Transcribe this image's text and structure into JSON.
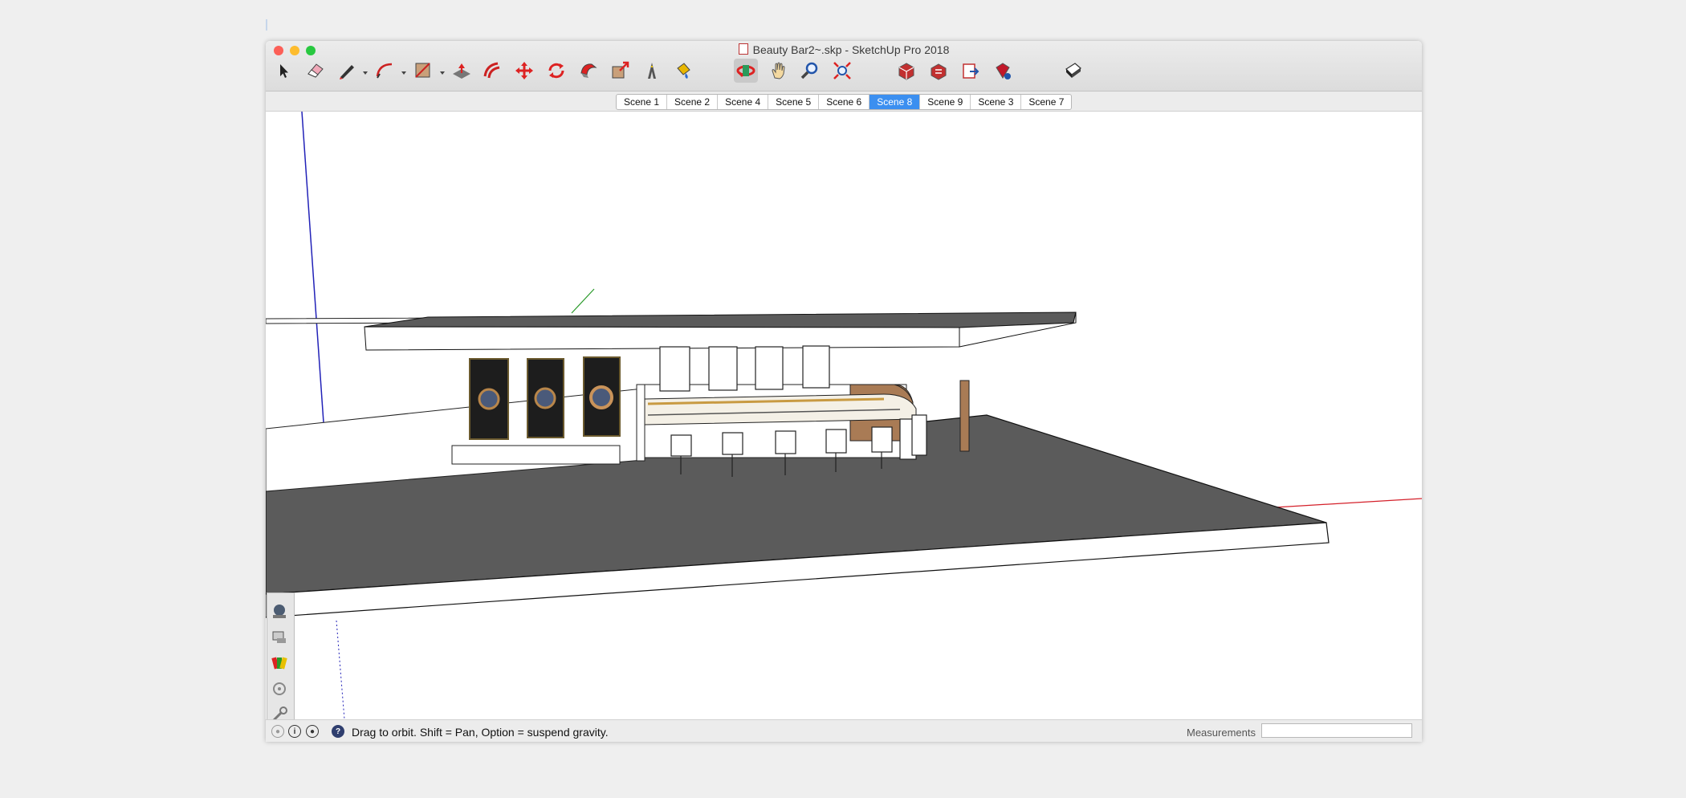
{
  "window": {
    "title": "Beauty Bar2~.skp - SketchUp Pro 2018",
    "traffic_colors": [
      "#fc5f57",
      "#fdbc2e",
      "#28c840"
    ]
  },
  "toolbar": {
    "tools": [
      "select-tool",
      "eraser-tool",
      "line-tool",
      "arc-tool",
      "rectangle-tool",
      "push-pull-tool",
      "offset-tool",
      "move-tool",
      "rotate-tool",
      "follow-me-tool",
      "scale-tool",
      "tape-measure-tool",
      "paint-bucket-tool",
      "orbit-tool",
      "pan-tool",
      "zoom-tool",
      "zoom-extents-tool",
      "warehouse-tool",
      "share-model-tool",
      "send-to-layout-tool",
      "extension-warehouse-tool",
      "display-toggle-tool"
    ],
    "active_tool": "orbit-tool"
  },
  "scenes": {
    "tabs": [
      "Scene 1",
      "Scene 2",
      "Scene 4",
      "Scene 5",
      "Scene 6",
      "Scene 8",
      "Scene 9",
      "Scene 3",
      "Scene 7"
    ],
    "selected": "Scene 8"
  },
  "side_panel": {
    "icons": [
      "styles-icon",
      "component-icon",
      "materials-icon",
      "scenes-icon",
      "tools-icon",
      "outliner-icon",
      "instructor-icon"
    ]
  },
  "status": {
    "icons": [
      "geolocation-icon",
      "credits-icon",
      "user-icon",
      "help-icon"
    ],
    "message": "Drag to orbit. Shift = Pan, Option = suspend gravity.",
    "measurements_label": "Measurements",
    "measurements_value": ""
  },
  "colors": {
    "axis_red": "#d4202a",
    "axis_green": "#2a9a2a",
    "axis_blue": "#2222b8",
    "floor": "#5b5b5b",
    "wood": "#a97b55",
    "selected_scene": "#3b8ff0"
  }
}
